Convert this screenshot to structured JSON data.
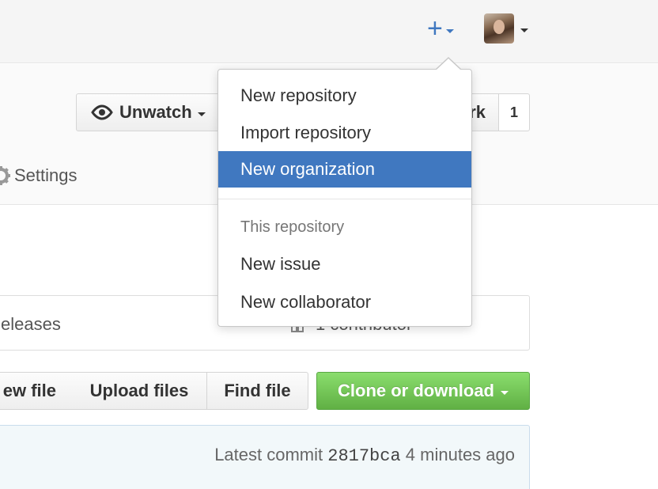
{
  "header": {
    "plus_glyph": "+",
    "accent_color": "#4078c0"
  },
  "repohead": {
    "watch_label": "Unwatch",
    "fork_label": "rk",
    "fork_count": "1",
    "settings_label": "Settings"
  },
  "summary": {
    "releases_label": "eleases",
    "contributors_label": "1 contributor"
  },
  "file_nav": {
    "new_file_label": "ew file",
    "upload_label": "Upload files",
    "find_label": "Find file",
    "clone_label": "Clone or download",
    "clone_color": "#6cc644"
  },
  "commit": {
    "latest_label": "Latest commit",
    "sha": "2817bca",
    "time": "4 minutes ago"
  },
  "dropdown": {
    "items_top": [
      {
        "label": "New repository"
      },
      {
        "label": "Import repository"
      },
      {
        "label": "New organization"
      }
    ],
    "section_header": "This repository",
    "items_bottom": [
      {
        "label": "New issue"
      },
      {
        "label": "New collaborator"
      }
    ],
    "highlight_color": "#4078c0"
  }
}
